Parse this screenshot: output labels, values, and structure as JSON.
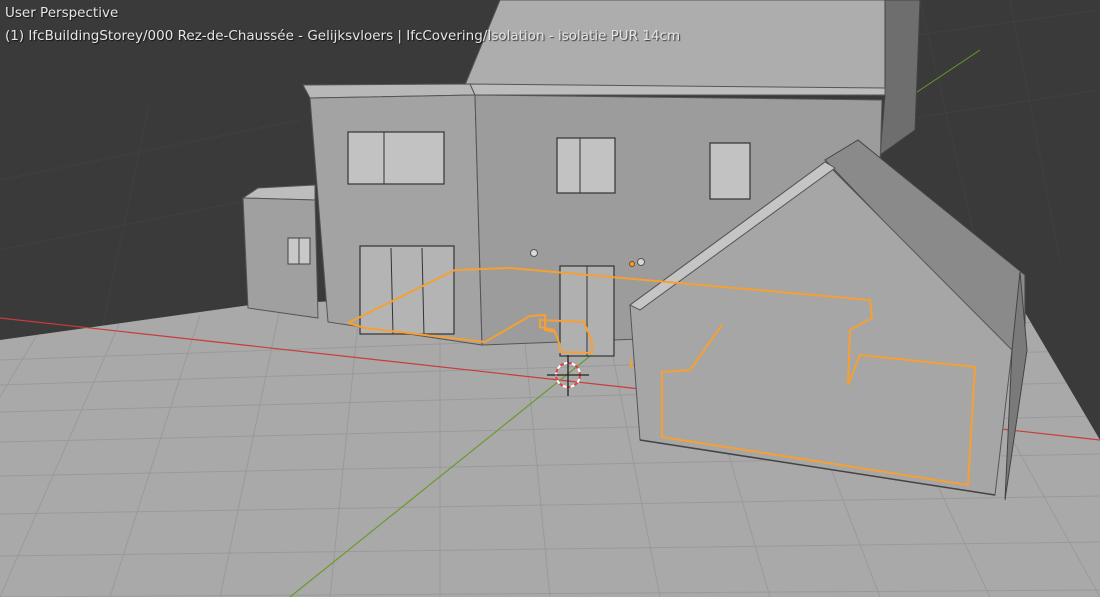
{
  "viewport": {
    "view_mode": "User Perspective",
    "active_object": "(1) IfcBuildingStorey/000 Rez-de-Chaussée - Gelijksvloers | IfcCovering/Isolation - isolatie PUR 14cm"
  },
  "colors": {
    "background": "#3a3a3a",
    "ground": "#a9a9a9",
    "wall_light": "#a3a3a3",
    "wall_mid": "#9a9a9a",
    "roof": "#adadad",
    "roof_dark": "#8a8a8a",
    "selection_outline": "#f5a034",
    "x_axis": "#c83c3c",
    "y_axis": "#6a9a2a",
    "cursor_red": "#e04040"
  },
  "icons": [
    "3d-cursor-icon",
    "origin-point-icon"
  ]
}
